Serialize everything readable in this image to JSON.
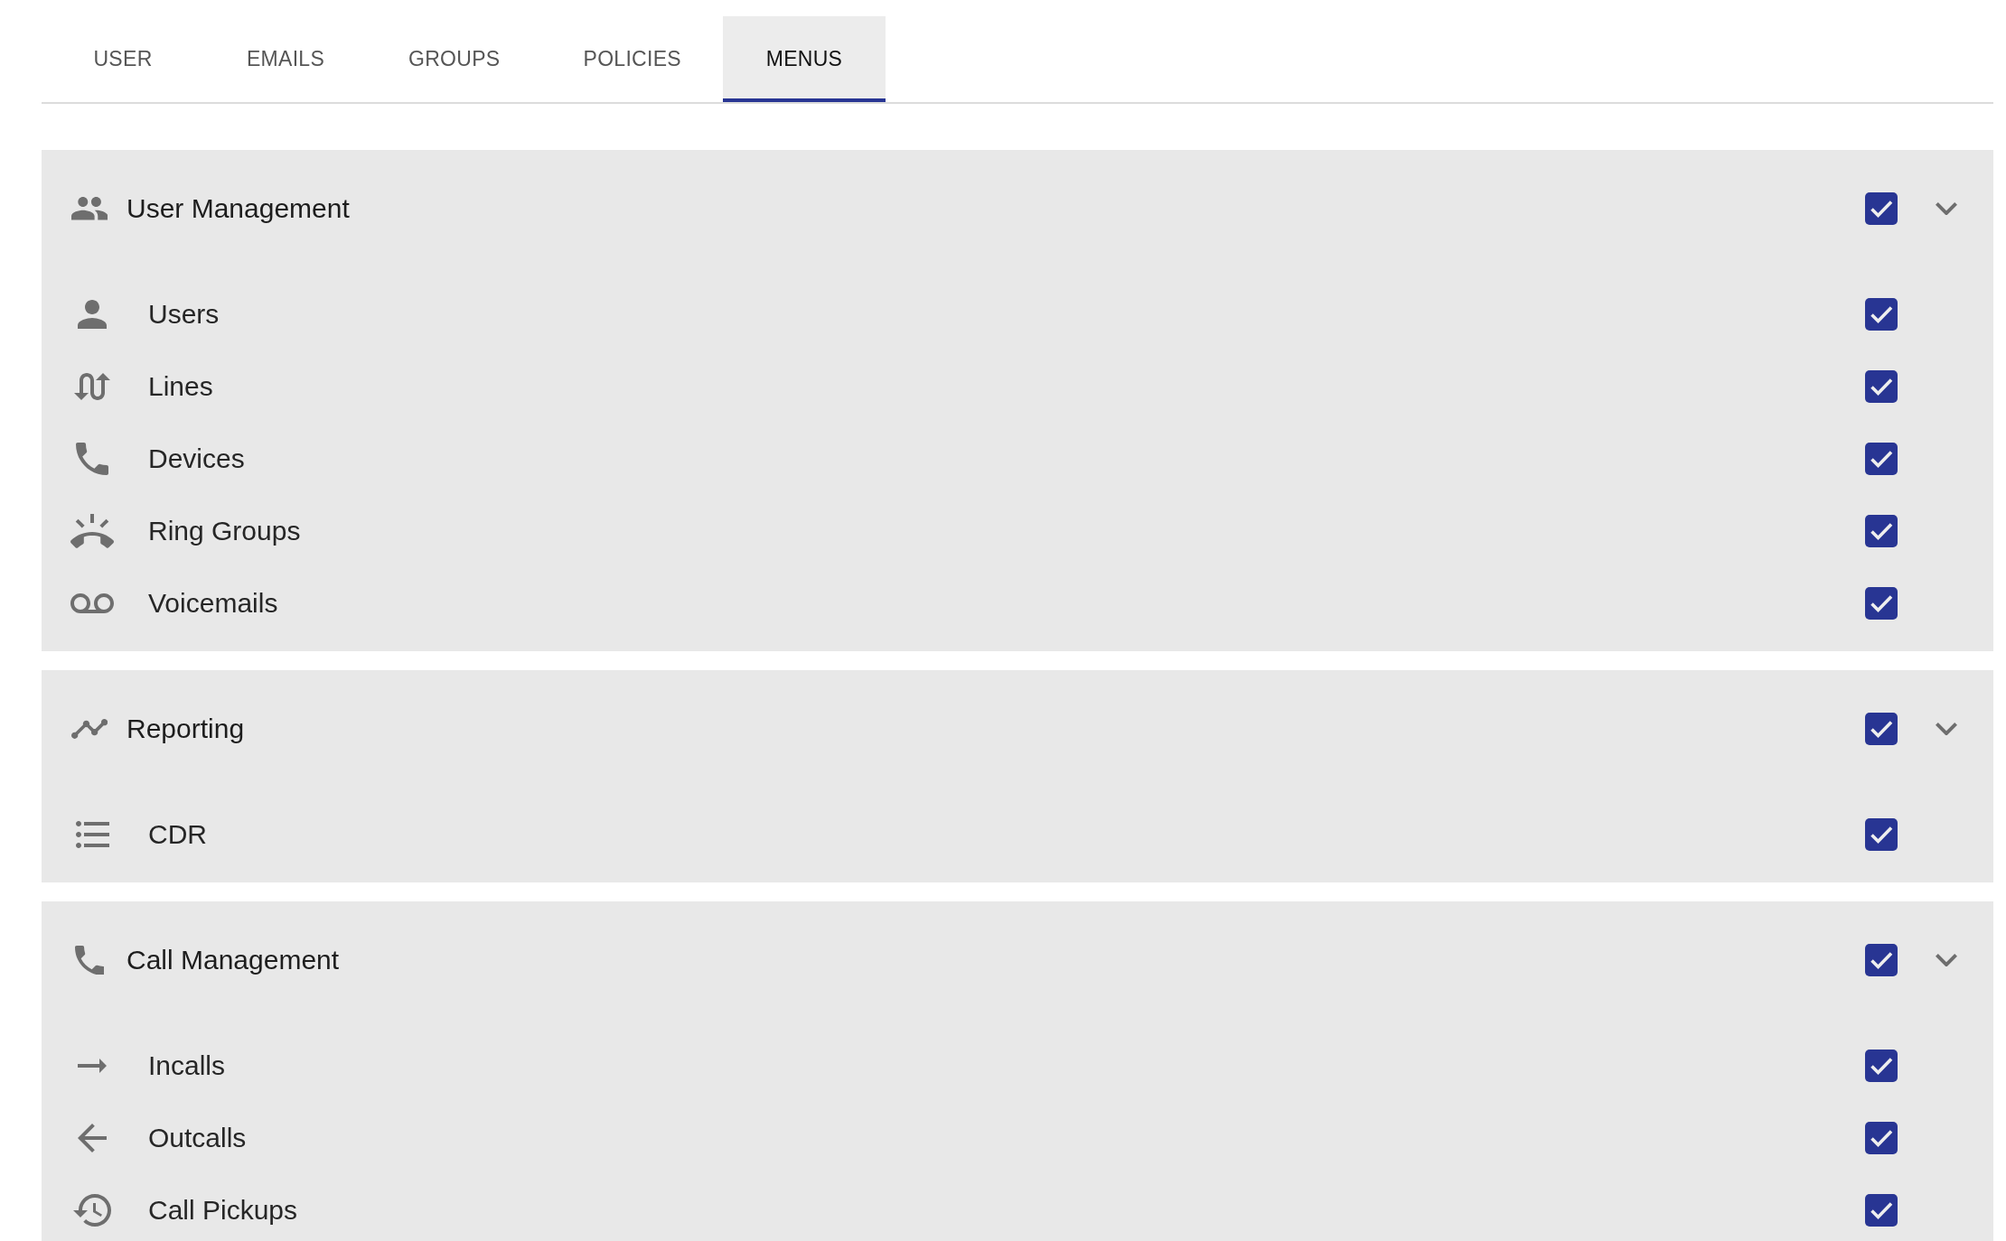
{
  "tabs": [
    {
      "label": "USER",
      "selected": false
    },
    {
      "label": "EMAILS",
      "selected": false
    },
    {
      "label": "GROUPS",
      "selected": false
    },
    {
      "label": "POLICIES",
      "selected": false
    },
    {
      "label": "MENUS",
      "selected": true
    }
  ],
  "sections": [
    {
      "title": "User Management",
      "checked": true,
      "expanded": true,
      "items": [
        {
          "label": "Users",
          "checked": true
        },
        {
          "label": "Lines",
          "checked": true
        },
        {
          "label": "Devices",
          "checked": true
        },
        {
          "label": "Ring Groups",
          "checked": true
        },
        {
          "label": "Voicemails",
          "checked": true
        }
      ]
    },
    {
      "title": "Reporting",
      "checked": true,
      "expanded": true,
      "items": [
        {
          "label": "CDR",
          "checked": true
        }
      ]
    },
    {
      "title": "Call Management",
      "checked": true,
      "expanded": true,
      "items": [
        {
          "label": "Incalls",
          "checked": true
        },
        {
          "label": "Outcalls",
          "checked": true
        },
        {
          "label": "Call Pickups",
          "checked": true
        }
      ]
    }
  ]
}
